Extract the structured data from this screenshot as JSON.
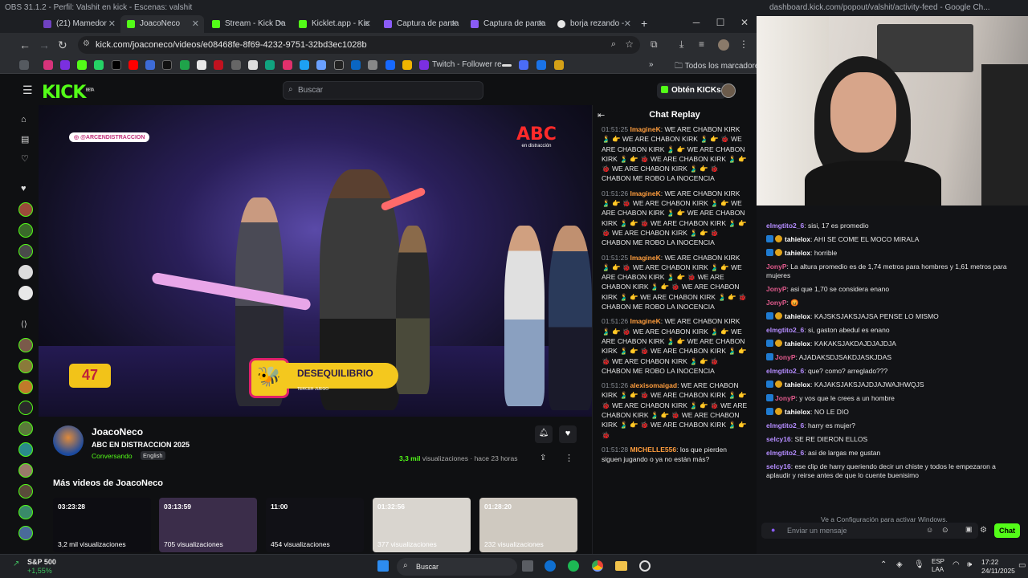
{
  "obs_title": "OBS 31.1.2 - Perfil: Valshit en kick - Escenas: valshit",
  "tabs": [
    {
      "label": "(21) Mamedor",
      "color": "#6f42c1"
    },
    {
      "label": "JoacoNeco",
      "color": "#53fc18"
    },
    {
      "label": "Stream - Kick Da",
      "color": "#53fc18"
    },
    {
      "label": "Kicklet.app - Kic",
      "color": "#53fc18"
    },
    {
      "label": "Captura de panta",
      "color": "#8a5cf6"
    },
    {
      "label": "Captura de panta",
      "color": "#8a5cf6"
    },
    {
      "label": "borja rezando -",
      "color": "#e6e6e6"
    }
  ],
  "new_tab": "+",
  "window_controls": {
    "minimize": "─",
    "maximize": "☐",
    "close": "✕"
  },
  "url": "kick.com/joaconeco/videos/e08468fe-8f69-4232-9751-32bd3ec1028b",
  "bookmarks": {
    "twitch_label": "Twitch - Follower re...",
    "all_bookmarks": "Todos los marcadores",
    "more": "»"
  },
  "kick": {
    "logo": "KICK",
    "logo_badge": "BETA",
    "search_placeholder": "Buscar",
    "get_kicks": "Obtén KICKs"
  },
  "video": {
    "watermark": "@ARCENDISTRACCION",
    "brand": "ABC",
    "brand_sub": "en distracción",
    "score": "47",
    "banner": "DESEQUILIBRIO",
    "banner_sub": "TERCER JUEGO"
  },
  "channel": {
    "name": "JoacoNeco",
    "title": "ABC EN DISTRACCION 2025",
    "category": "Conversando",
    "language": "English",
    "views": "3,3 mil",
    "views_label": "visualizaciones",
    "age": "hace 23 horas"
  },
  "more_videos_title": "Más videos de JoacoNeco",
  "thumbs": [
    {
      "duration": "03:23:28",
      "views": "3,2 mil visualizaciones",
      "bg": "#0d0d12"
    },
    {
      "duration": "03:13:59",
      "views": "705 visualizaciones",
      "bg": "#3b2d4a"
    },
    {
      "duration": "11:00",
      "views": "454 visualizaciones",
      "bg": "#111116"
    },
    {
      "duration": "01:32:56",
      "views": "377 visualizaciones",
      "bg": "#d9d5cf"
    },
    {
      "duration": "01:28:20",
      "views": "232 visualizaciones",
      "bg": "#cfc9c0"
    }
  ],
  "chat": {
    "header": "Chat Replay",
    "messages": [
      {
        "time": "01:51:25",
        "user": "ImagineK",
        "color": "#ff9d3d",
        "text": "WE ARE CHABON KIRK 🫃 👉 WE ARE CHABON KIRK 🫃 👉 🐞 WE ARE CHABON KIRK 🫃 👉 WE ARE CHABON KIRK 🫃 👉 🐞 WE ARE CHABON KIRK 🫃 👉 🐞 WE ARE CHABON KIRK 🫃 👉 🐞 CHABON ME ROBO LA INOCENCIA"
      },
      {
        "time": "01:51:26",
        "user": "ImagineK",
        "color": "#ff9d3d",
        "text": "WE ARE CHABON KIRK 🫃 👉 🐞 WE ARE CHABON KIRK 🫃 👉 WE ARE CHABON KIRK 🫃 👉 WE ARE CHABON KIRK 🫃 👉 🐞 WE ARE CHABON KIRK 🫃 👉 🐞 WE ARE CHABON KIRK 🫃 👉 🐞 CHABON ME ROBO LA INOCENCIA"
      },
      {
        "time": "01:51:25",
        "user": "ImagineK",
        "color": "#ff9d3d",
        "text": "WE ARE CHABON KIRK 🫃 👉 🐞 WE ARE CHABON KIRK 🫃 👉 WE ARE CHABON KIRK 🫃 👉 🐞 WE ARE CHABON KIRK 🫃 👉 🐞 WE ARE CHABON KIRK 🫃 👉 WE ARE CHABON KIRK 🫃 👉 🐞 CHABON ME ROBO LA INOCENCIA"
      },
      {
        "time": "01:51:26",
        "user": "ImagineK",
        "color": "#ff9d3d",
        "text": "WE ARE CHABON KIRK 🫃 👉 🐞 WE ARE CHABON KIRK 🫃 👉 WE ARE CHABON KIRK 🫃 👉 WE ARE CHABON KIRK 🫃 👉 🐞 WE ARE CHABON KIRK 🫃 👉 🐞 WE ARE CHABON KIRK 🫃 👉 🐞 CHABON ME ROBO LA INOCENCIA"
      },
      {
        "time": "01:51:26",
        "user": "alexisomaigad",
        "color": "#ff9d3d",
        "text": "WE ARE CHABON KIRK 🫃 👉 🐞 WE ARE CHABON KIRK 🫃 👉 🐞 WE ARE CHABON KIRK 🫃 👉 🐞 WE ARE CHABON KIRK 🫃 👉 🐞 WE ARE CHABON KIRK 🫃 👉 🐞 WE ARE CHABON KIRK 🫃 👉 🐞"
      },
      {
        "time": "01:51:28",
        "user": "MICHELLE556",
        "color": "#ff9d3d",
        "text": "los que pierden siguen jugando o ya no están más?"
      }
    ]
  },
  "right": {
    "title": "dashboard.kick.com/popout/valshit/activity-feed - Google Ch...",
    "feed": [
      {
        "user": "elmgtito2_6",
        "color": "#b48cff",
        "text": "sisi, 17 es promedio",
        "badges": ""
      },
      {
        "user": "tahielox",
        "color": "#ffffff",
        "text": "AHI SE COME EL MOCO MIRALA",
        "badges": "ms"
      },
      {
        "user": "tahielox",
        "color": "#ffffff",
        "text": "horrible",
        "badges": "ms"
      },
      {
        "user": "JonyP",
        "color": "#e05a8c",
        "text": "La altura promedio es de 1,74 metros para hombres y 1,61 metros para mujeres",
        "badges": ""
      },
      {
        "user": "JonyP",
        "color": "#e05a8c",
        "text": "asi que 1,70 se considera enano",
        "badges": ""
      },
      {
        "user": "JonyP",
        "color": "#e05a8c",
        "text": "😡",
        "badges": ""
      },
      {
        "user": "tahielox",
        "color": "#ffffff",
        "text": "KAJSKSJAKSJAJSA PENSE LO MISMO",
        "badges": "ms"
      },
      {
        "user": "elmgtito2_6",
        "color": "#b48cff",
        "text": "si, gaston abedul es enano",
        "badges": ""
      },
      {
        "user": "tahielox",
        "color": "#ffffff",
        "text": "KAKAKSJAKDAJDJAJDJA",
        "badges": "ms"
      },
      {
        "user": "JonyP",
        "color": "#e05a8c",
        "text": "AJADAKSDJSAKDJASKJDAS",
        "badges": "m"
      },
      {
        "user": "elmgtito2_6",
        "color": "#b48cff",
        "text": "que? como? arreglado???",
        "badges": ""
      },
      {
        "user": "tahielox",
        "color": "#ffffff",
        "text": "KAJAKSJAKSJAJDJAJWAJHWQJS",
        "badges": "ms"
      },
      {
        "user": "JonyP",
        "color": "#e05a8c",
        "text": "y vos que le crees a un hombre",
        "badges": "m"
      },
      {
        "user": "tahielox",
        "color": "#ffffff",
        "text": "NO LE DIO",
        "badges": "ms"
      },
      {
        "user": "elmgtito2_6",
        "color": "#b48cff",
        "text": "harry es mujer?",
        "badges": ""
      },
      {
        "user": "selcy16",
        "color": "#b48cff",
        "text": "SE RE DIERON ELLOS",
        "badges": ""
      },
      {
        "user": "elmgtito2_6",
        "color": "#b48cff",
        "text": "asi de largas me gustan",
        "badges": ""
      },
      {
        "user": "selcy16",
        "color": "#b48cff",
        "text": "ese clip de harry queriendo decir un chiste y todos le empezaron a aplaudir y reirse antes de que lo cuente buenisimo",
        "badges": ""
      }
    ],
    "windows_watermark": "Ve a Configuración para activar Windows.",
    "input_placeholder": "Enviar un mensaje",
    "chat_button": "Chat"
  },
  "taskbar": {
    "stock_name": "S&P 500",
    "stock_change": "+1,55%",
    "search": "Buscar",
    "lang1": "ESP",
    "lang2": "LAA",
    "time": "17:22",
    "date": "24/11/2025"
  }
}
